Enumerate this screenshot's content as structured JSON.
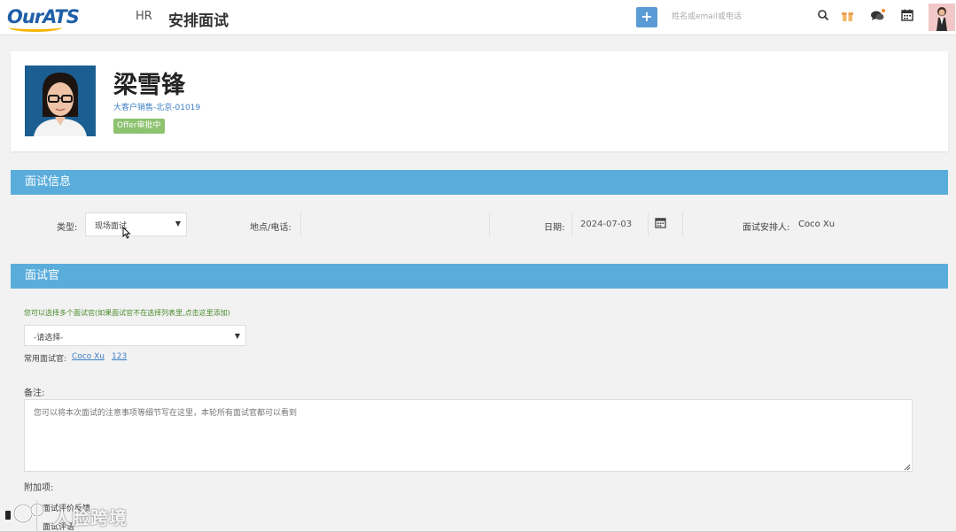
{
  "brand": {
    "logo_text": "OurATS",
    "brand_blue": "#1f5fa8",
    "brand_yellow": "#f5b400"
  },
  "header": {
    "nav_hr": "HR",
    "page_title": "安排面试",
    "add_label": "+",
    "search_placeholder": "姓名或email或电话",
    "icons": [
      "search-icon",
      "gift-icon",
      "chat-icon",
      "calendar-icon",
      "user-avatar"
    ]
  },
  "candidate": {
    "name": "梁雪锋",
    "job": "大客户销售-北京-01019",
    "status_badge": "Offer审批中",
    "badge_color": "#8dc26f"
  },
  "interview_info": {
    "section_title": "面试信息",
    "type_label": "类型:",
    "type_value": "现场面试",
    "location_label": "地点/电话:",
    "location_value": "",
    "date_label": "日期:",
    "date_value": "2024-07-03",
    "arranger_label": "面试安排人:",
    "arranger_value": "Coco Xu"
  },
  "interviewers": {
    "section_title": "面试官",
    "hint": "您可以选择多个面试官(如果面试官不在选择列表里,点击这里添加)",
    "select_placeholder": "-请选择-",
    "common_label": "常用面试官:",
    "common_list": [
      "Coco Xu",
      "123"
    ]
  },
  "remark": {
    "label": "备注:",
    "placeholder": "您可以将本次面试的注意事项等细节写在这里，本轮所有面试官都可以看到"
  },
  "attachments": {
    "label": "附加项:",
    "items": [
      "面试评价反馈",
      "面试评语"
    ]
  },
  "watermark": {
    "text": "人脸跨境"
  },
  "colors": {
    "section_header": "#5aaddb",
    "link": "#3a7cc5",
    "add_button": "#5b9bd5"
  }
}
